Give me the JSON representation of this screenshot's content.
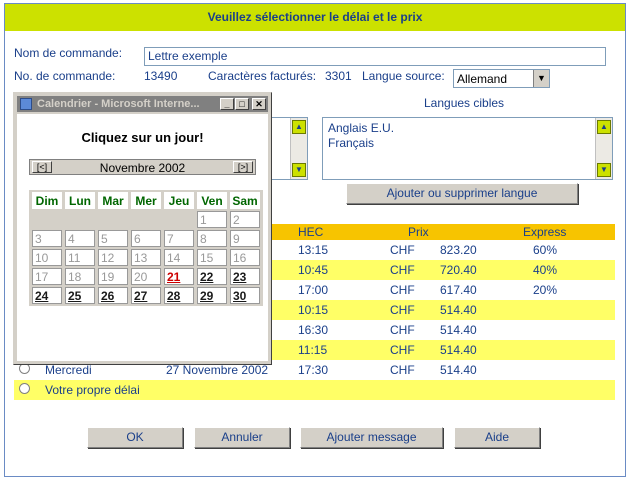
{
  "header": {
    "title": "Veuillez sélectionner le délai et le prix"
  },
  "order": {
    "name_label": "Nom de commande:",
    "name_value": "Lettre exemple",
    "number_label": "No. de commande:",
    "number_value": "13490",
    "chars_label": "Caractères facturés:",
    "chars_value": "3301",
    "source_label": "Langue source:",
    "source_value": "Allemand"
  },
  "targets": {
    "label": "Langues cibles",
    "items": [
      "Anglais E.U.",
      "Français"
    ],
    "button": "Ajouter ou supprimer langue"
  },
  "table": {
    "headers": {
      "hec": "HEC",
      "prix": "Prix",
      "express": "Express"
    },
    "rows": [
      {
        "day": "",
        "date": "",
        "hec": "13:15",
        "cur": "CHF",
        "price": "823.20",
        "express": "60%"
      },
      {
        "day": "",
        "date": "",
        "hec": "10:45",
        "cur": "CHF",
        "price": "720.40",
        "express": "40%"
      },
      {
        "day": "",
        "date": "",
        "hec": "17:00",
        "cur": "CHF",
        "price": "617.40",
        "express": "20%"
      },
      {
        "day": "",
        "date": "",
        "hec": "10:15",
        "cur": "CHF",
        "price": "514.40",
        "express": ""
      },
      {
        "day": "",
        "date": "",
        "hec": "16:30",
        "cur": "CHF",
        "price": "514.40",
        "express": ""
      },
      {
        "day": "",
        "date": "",
        "hec": "11:15",
        "cur": "CHF",
        "price": "514.40",
        "express": ""
      },
      {
        "day": "Mercredi",
        "date": "27 Novembre 2002",
        "hec": "17:30",
        "cur": "CHF",
        "price": "514.40",
        "express": ""
      }
    ],
    "own_deadline": "Votre propre délai"
  },
  "buttons": {
    "ok": "OK",
    "cancel": "Annuler",
    "add_message": "Ajouter message",
    "help": "Aide"
  },
  "calendar": {
    "window_title": "Calendrier - Microsoft Interne...",
    "prompt": "Cliquez sur un jour!",
    "prev": "[<]",
    "next": "[>]",
    "month": "Novembre 2002",
    "weekdays": [
      "Dim",
      "Lun",
      "Mar",
      "Mer",
      "Jeu",
      "Ven",
      "Sam"
    ],
    "weeks": [
      [
        "",
        "",
        "",
        "",
        "",
        "1",
        "2"
      ],
      [
        "3",
        "4",
        "5",
        "6",
        "7",
        "8",
        "9"
      ],
      [
        "10",
        "11",
        "12",
        "13",
        "14",
        "15",
        "16"
      ],
      [
        "17",
        "18",
        "19",
        "20",
        "21",
        "22",
        "23"
      ],
      [
        "24",
        "25",
        "26",
        "27",
        "28",
        "29",
        "30"
      ]
    ],
    "today": "21"
  },
  "colors": {
    "accent": "#cce100",
    "header_band": "#f7c400",
    "row_highlight": "#ffff66",
    "text": "#1a3f8a"
  }
}
